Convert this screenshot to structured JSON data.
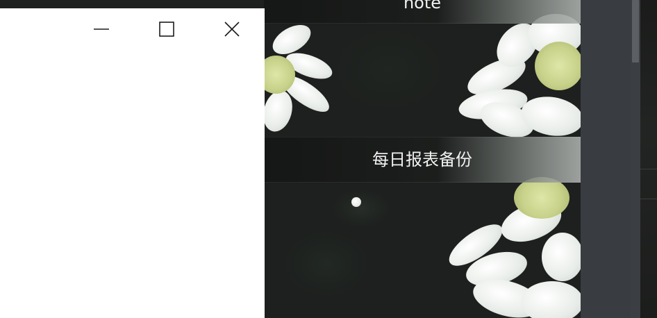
{
  "notes": [
    {
      "title": "note"
    },
    {
      "title": "每日报表备份"
    }
  ],
  "window": {
    "controls": [
      "minimize-icon",
      "maximize-icon",
      "close-icon"
    ]
  },
  "colors": {
    "window_bg": "#ffffff",
    "side_panel": "#393c40",
    "scroll_thumb": "#5c6065",
    "header_text": "#f2f2f2"
  }
}
